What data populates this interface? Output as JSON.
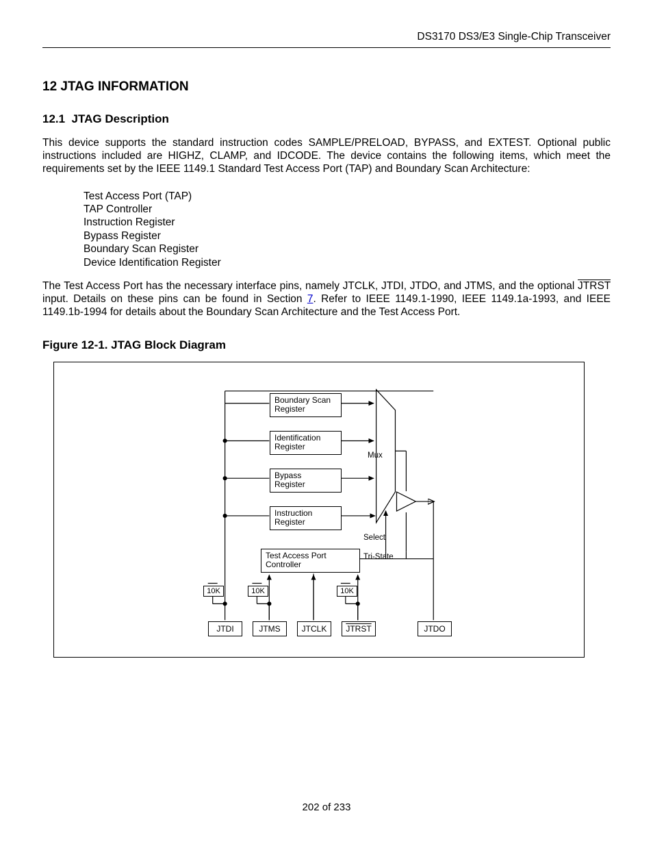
{
  "header": {
    "right": "DS3170 DS3/E3 Single-Chip Transceiver"
  },
  "section": {
    "number": "12",
    "title": "JTAG INFORMATION",
    "sub_number": "12.1",
    "sub_title": "JTAG Description"
  },
  "body": {
    "p1": "This device supports the standard instruction codes SAMPLE/PRELOAD, BYPASS, and EXTEST. Optional public instructions included are HIGHZ, CLAMP, and IDCODE. The device contains the following items, which meet the requirements set by the IEEE 1149.1 Standard Test Access Port (TAP) and Boundary Scan Architecture:",
    "list": [
      "Test Access Port (TAP)",
      "TAP Controller",
      "Instruction Register",
      "Bypass Register",
      "Boundary Scan Register",
      "Device Identification Register"
    ],
    "p2_pre": "The Test Access Port has the necessary interface pins, namely JTCLK, JTDI, JTDO, and JTMS, and the optional ",
    "p2_jtrst": "JTRST",
    "p2_mid": " input. Details on these pins can be found in Section ",
    "p2_link": "7",
    "p2_post": ". Refer to IEEE 1149.1-1990, IEEE 1149.1a-1993, and IEEE 1149.1b-1994 for details about the Boundary Scan Architecture and the Test Access Port."
  },
  "figure": {
    "title": "Figure 12-1. JTAG Block Diagram",
    "blocks": {
      "bsr1": "Boundary Scan",
      "bsr2": "Register",
      "idr1": "Identification",
      "idr2": "Register",
      "byp1": "Bypass",
      "byp2": "Register",
      "ir1": "Instruction",
      "ir2": "Register",
      "tap1": "Test Access Port",
      "tap2": "Controller",
      "mux": "Mux",
      "select": "Select",
      "tristate": "Tri-State",
      "r10k1": "10K",
      "r10k2": "10K",
      "r10k3": "10K"
    },
    "pins": {
      "jtdi": "JTDI",
      "jtms": "JTMS",
      "jtclk": "JTCLK",
      "jtrst": "JTRST",
      "jtdo": "JTDO"
    }
  },
  "footer": {
    "page": "202 of 233"
  }
}
